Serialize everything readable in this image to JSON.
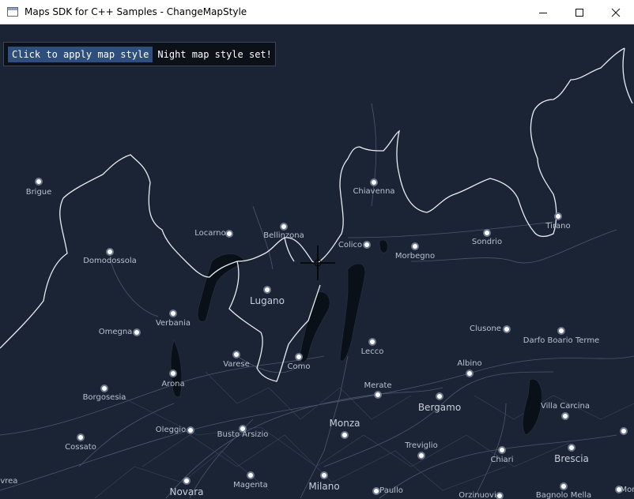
{
  "window": {
    "title": "Maps SDK for C++ Samples - ChangeMapStyle",
    "minimize_icon": "minimize-icon",
    "maximize_icon": "maximize-icon",
    "close_icon": "close-icon"
  },
  "toolbar": {
    "apply_button_label": "Click to apply map style",
    "status": "Night map style set!"
  },
  "map": {
    "style": "night",
    "colors": {
      "background": "#1b2434",
      "border": "#ffffff",
      "water": "#0a1018",
      "roads": "#5f6b80"
    },
    "cities": [
      {
        "name": "Brigue",
        "size": "small"
      },
      {
        "name": "Chiavenna",
        "size": "small"
      },
      {
        "name": "Tirano",
        "size": "small"
      },
      {
        "name": "Locarno",
        "size": "small"
      },
      {
        "name": "Bellinzona",
        "size": "small"
      },
      {
        "name": "Colico",
        "size": "small"
      },
      {
        "name": "Sondrio",
        "size": "small"
      },
      {
        "name": "Domodossola",
        "size": "small"
      },
      {
        "name": "Morbegno",
        "size": "small"
      },
      {
        "name": "Lugano",
        "size": "big"
      },
      {
        "name": "Verbania",
        "size": "small"
      },
      {
        "name": "Omegna",
        "size": "small"
      },
      {
        "name": "Clusone",
        "size": "small"
      },
      {
        "name": "Darfo Boario Terme",
        "size": "small"
      },
      {
        "name": "Lecco",
        "size": "small"
      },
      {
        "name": "Varese",
        "size": "small"
      },
      {
        "name": "Como",
        "size": "small"
      },
      {
        "name": "Albino",
        "size": "small"
      },
      {
        "name": "Arona",
        "size": "small"
      },
      {
        "name": "Merate",
        "size": "small"
      },
      {
        "name": "Borgosesia",
        "size": "small"
      },
      {
        "name": "Bergamo",
        "size": "big"
      },
      {
        "name": "Villa Carcina",
        "size": "small"
      },
      {
        "name": "Oleggio",
        "size": "small"
      },
      {
        "name": "Busto Arsizio",
        "size": "small"
      },
      {
        "name": "Monza",
        "size": "big"
      },
      {
        "name": "Cossato",
        "size": "small"
      },
      {
        "name": "Treviglio",
        "size": "small"
      },
      {
        "name": "Chiari",
        "size": "small"
      },
      {
        "name": "Brescia",
        "size": "big"
      },
      {
        "name": "Magenta",
        "size": "small"
      },
      {
        "name": "Novara",
        "size": "big"
      },
      {
        "name": "Milano",
        "size": "big"
      },
      {
        "name": "Paullo",
        "size": "small"
      },
      {
        "name": "Orzinuovi",
        "size": "small"
      },
      {
        "name": "Bagnolo Mella",
        "size": "small"
      },
      {
        "name": "ivrea",
        "size": "small"
      },
      {
        "name": "Mon",
        "size": "small"
      }
    ]
  }
}
